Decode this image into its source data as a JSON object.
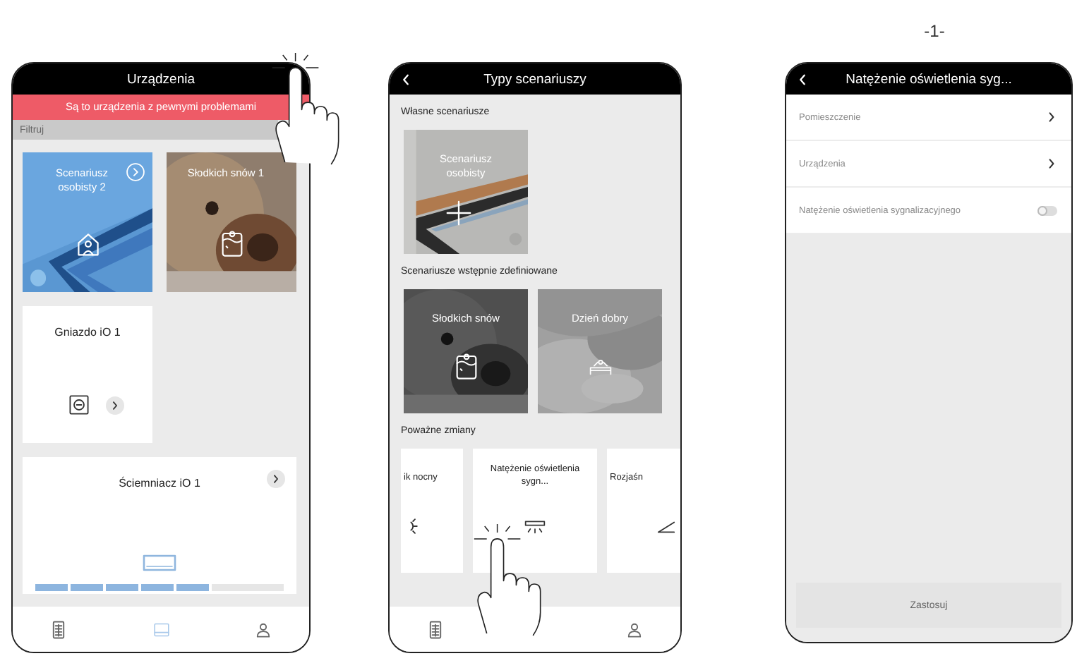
{
  "figure_label": "-1-",
  "devices_screen": {
    "title": "Urządzenia",
    "alert": "Są to urządzenia z pewnymi problemami",
    "filter": "Filtruj",
    "scenario_tiles": [
      {
        "kind": "custom",
        "title": "Scenariusz osobisty 2",
        "arrow": true
      },
      {
        "kind": "sleep",
        "title": "Słodkich snów 1",
        "arrow": false
      }
    ],
    "device_tiles": [
      {
        "kind": "socket",
        "name": "Gniazdo iO 1"
      },
      {
        "kind": "dimmer",
        "name": "Ściemniacz iO 1",
        "level": 0.71
      }
    ],
    "nav": [
      {
        "kind": "devices",
        "selected": false
      },
      {
        "kind": "scenarios",
        "selected": true
      },
      {
        "kind": "user",
        "selected": false
      }
    ]
  },
  "scenario_types_screen": {
    "title": "Typy scenariuszy",
    "back": true,
    "sections": [
      {
        "kind": "custom",
        "heading": "Własne scenariusze",
        "items": [
          {
            "kind": "add",
            "title": "Scenariusz osobisty"
          }
        ]
      },
      {
        "kind": "predefined",
        "heading": "Scenariusze wstępnie zdefiniowane",
        "items": [
          {
            "kind": "sleep",
            "title": "Słodkich snów"
          },
          {
            "kind": "morning",
            "title": "Dzień dobry"
          }
        ]
      },
      {
        "kind": "cards",
        "heading": "Poważne zmiany",
        "items": [
          {
            "kind": "night",
            "title": "ik nocny"
          },
          {
            "kind": "signal",
            "title": "Natężenie oświetlenia sygn..."
          },
          {
            "kind": "brighten",
            "title": "Rozjaśn"
          }
        ]
      }
    ],
    "nav": [
      {
        "kind": "devices",
        "selected": false
      },
      {
        "kind": "user",
        "selected": false
      }
    ]
  },
  "settings_screen": {
    "title": "Natężenie oświetlenia syg...",
    "back": true,
    "rows": [
      {
        "kind": "link",
        "label": "Pomieszczenie"
      },
      {
        "kind": "link",
        "label": "Urządzenia"
      },
      {
        "kind": "toggle",
        "label": "Natężenie oświetlenia sygnalizacyjnego",
        "on": false
      }
    ],
    "button": "Zastosuj"
  }
}
